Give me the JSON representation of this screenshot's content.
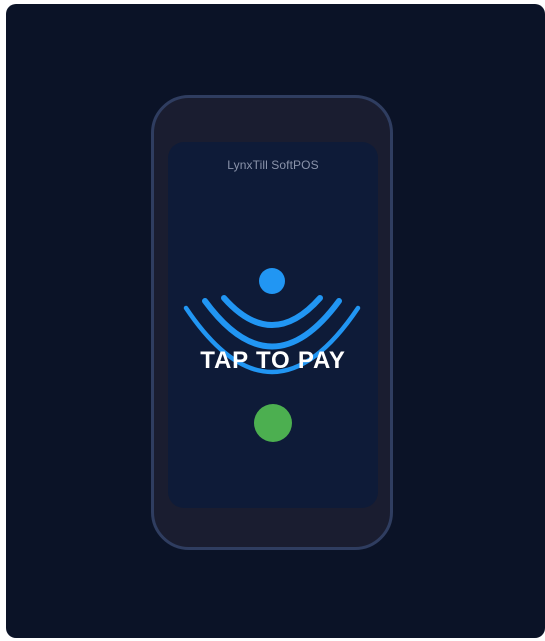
{
  "app": {
    "name": "LynxTill SoftPOS"
  },
  "payment": {
    "prompt": "TAP TO PAY"
  },
  "icons": {
    "contactless": "contactless-nfc-icon",
    "status": "status-indicator-dot"
  },
  "colors": {
    "background": "#0b1327",
    "phone_body": "#1a1d30",
    "phone_border": "#2f3d60",
    "screen": "#0e1b38",
    "accent_blue": "#2196f3",
    "status_green": "#4caf50",
    "app_name_text": "#8a93aa"
  }
}
